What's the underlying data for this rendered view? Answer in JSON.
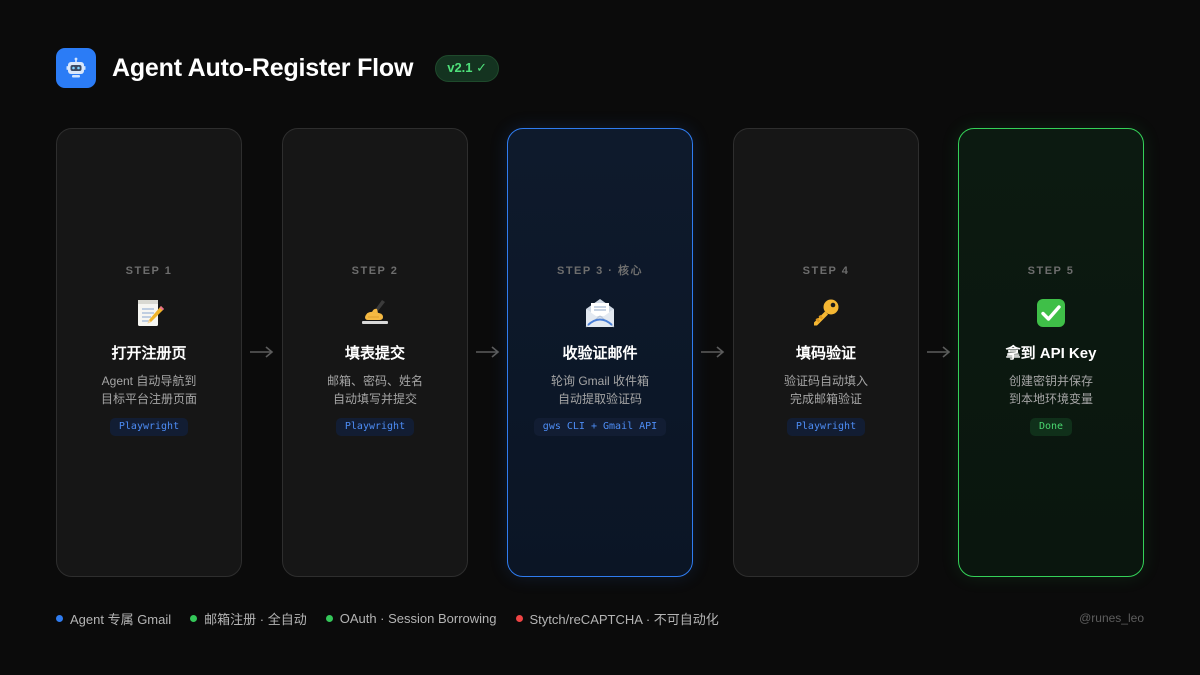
{
  "header": {
    "app_icon": "robot-icon",
    "title": "Agent Auto-Register Flow",
    "version": "v2.1 ✓"
  },
  "steps": [
    {
      "label": "STEP 1",
      "icon": "memo-icon",
      "title": "打开注册页",
      "desc_line1": "Agent 自动导航到",
      "desc_line2": "目标平台注册页面",
      "tag": "Playwright",
      "style": "default"
    },
    {
      "label": "STEP 2",
      "icon": "writing-hand-icon",
      "title": "填表提交",
      "desc_line1": "邮箱、密码、姓名",
      "desc_line2": "自动填写并提交",
      "tag": "Playwright",
      "style": "default"
    },
    {
      "label": "STEP 3 · 核心",
      "icon": "envelope-icon",
      "title": "收验证邮件",
      "desc_line1": "轮询 Gmail 收件箱",
      "desc_line2": "自动提取验证码",
      "tag": "gws CLI + Gmail API",
      "style": "highlight-blue"
    },
    {
      "label": "STEP 4",
      "icon": "key-icon",
      "title": "填码验证",
      "desc_line1": "验证码自动填入",
      "desc_line2": "完成邮箱验证",
      "tag": "Playwright",
      "style": "default"
    },
    {
      "label": "STEP 5",
      "icon": "check-mark-icon",
      "title": "拿到 API Key",
      "desc_line1": "创建密钥并保存",
      "desc_line2": "到本地环境变量",
      "tag": "Done",
      "style": "highlight-green"
    }
  ],
  "arrow_glyph": "→",
  "legend": [
    {
      "label": "Agent 专属 Gmail",
      "color": "#2f7cf0"
    },
    {
      "label": "邮箱注册 · 全自动",
      "color": "#34c759"
    },
    {
      "label": "OAuth · Session Borrowing",
      "color": "#34c759"
    },
    {
      "label": "Stytch/reCAPTCHA · 不可自动化",
      "color": "#ef4444"
    }
  ],
  "credit": "@runes_leo",
  "colors": {
    "background": "#0b0b0b",
    "accent_blue": "#2f7cf0",
    "accent_green": "#34d158",
    "card": "#161616"
  }
}
